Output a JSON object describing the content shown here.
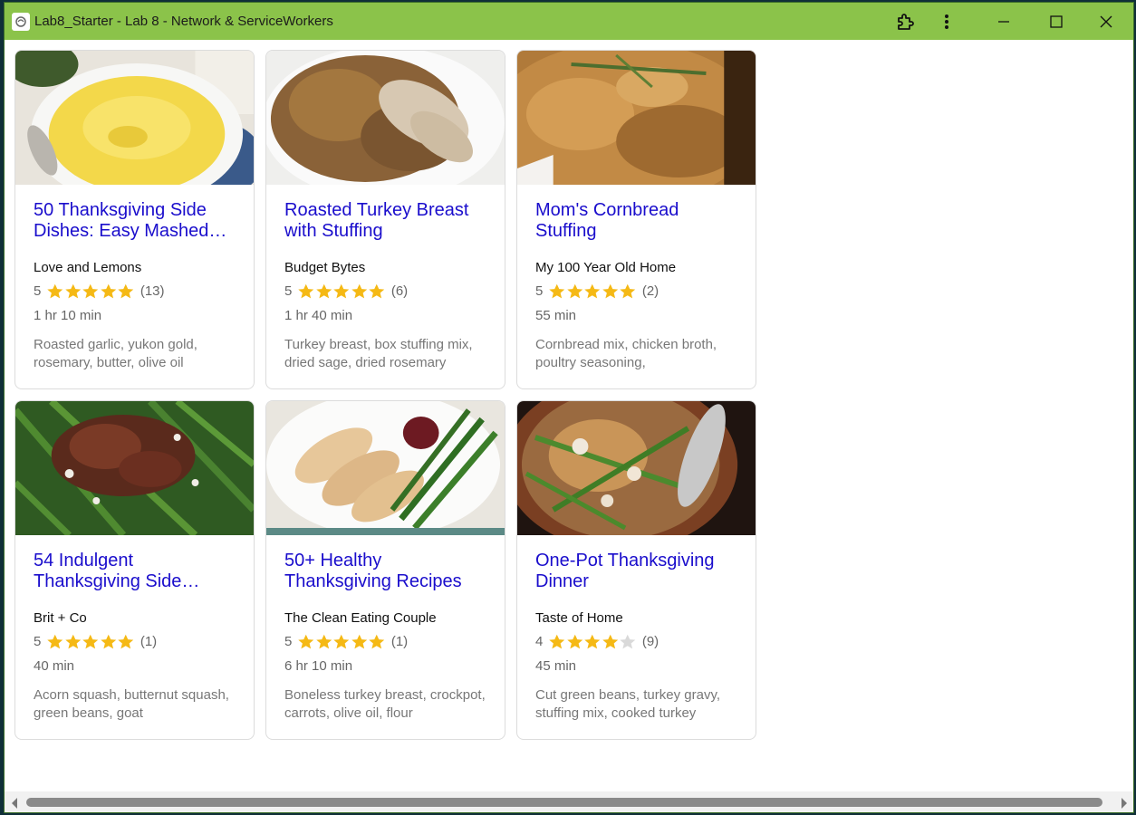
{
  "window": {
    "title": "Lab8_Starter - Lab 8 - Network & ServiceWorkers",
    "icons": [
      "app-icon",
      "extensions-icon",
      "more-menu-icon",
      "minimize-icon",
      "maximize-icon",
      "close-icon"
    ]
  },
  "colors": {
    "titlebar": "#8bc34a",
    "link": "#1a0dcc",
    "star_filled": "#f5b915",
    "star_empty": "#d9d9d9"
  },
  "recipes": [
    {
      "title": "50 Thanksgiving Side Dishes: Easy Mashed…",
      "source": "Love and Lemons",
      "rating": 5,
      "rating_label": "5",
      "reviews": "(13)",
      "time": "1 hr 10 min",
      "ingredients": "Roasted garlic, yukon gold, rosemary, butter, olive oil",
      "image": "mashed-potatoes-image"
    },
    {
      "title": "Roasted Turkey Breast with Stuffing",
      "source": "Budget Bytes",
      "rating": 5,
      "rating_label": "5",
      "reviews": "(6)",
      "time": "1 hr 40 min",
      "ingredients": "Turkey breast, box stuffing mix, dried sage, dried rosemary",
      "image": "turkey-stuffing-image"
    },
    {
      "title": "Mom's Cornbread Stuffing",
      "source": "My 100 Year Old Home",
      "rating": 5,
      "rating_label": "5",
      "reviews": "(2)",
      "time": "55 min",
      "ingredients": "Cornbread mix, chicken broth, poultry seasoning,",
      "image": "cornbread-stuffing-image"
    },
    {
      "title": "54 Indulgent Thanksgiving Side…",
      "source": "Brit + Co",
      "rating": 5,
      "rating_label": "5",
      "reviews": "(1)",
      "time": "40 min",
      "ingredients": "Acorn squash, butternut squash, green beans, goat",
      "image": "green-beans-image"
    },
    {
      "title": "50+ Healthy Thanksgiving Recipes",
      "source": "The Clean Eating Couple",
      "rating": 5,
      "rating_label": "5",
      "reviews": "(1)",
      "time": "6 hr 10 min",
      "ingredients": "Boneless turkey breast, crockpot, carrots, olive oil, flour",
      "image": "turkey-plate-image"
    },
    {
      "title": "One-Pot Thanksgiving Dinner",
      "source": "Taste of Home",
      "rating": 4,
      "rating_label": "4",
      "reviews": "(9)",
      "time": "45 min",
      "ingredients": "Cut green beans, turkey gravy, stuffing mix, cooked turkey",
      "image": "one-pot-dinner-image"
    }
  ]
}
